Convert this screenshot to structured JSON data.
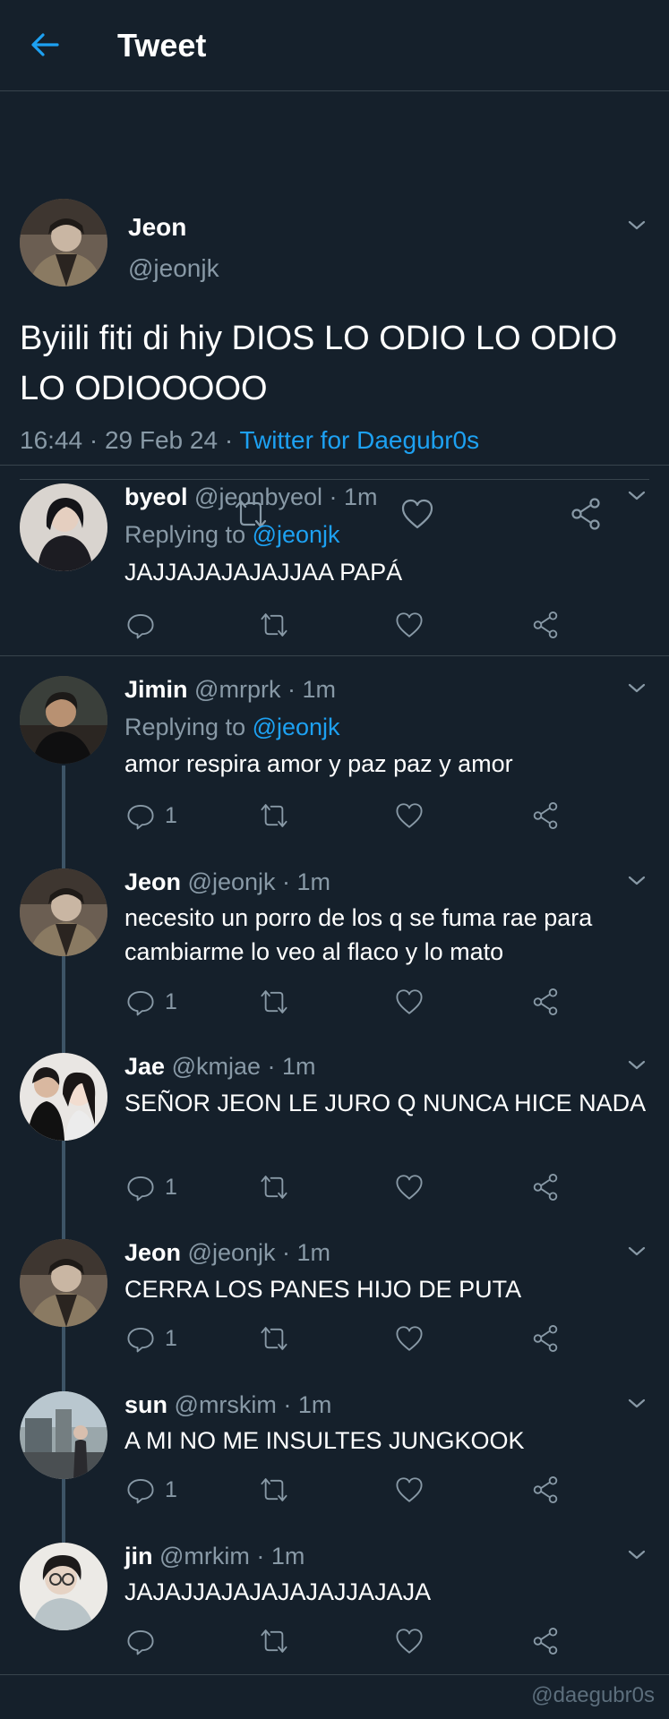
{
  "header": {
    "title": "Tweet"
  },
  "main_tweet": {
    "name": "Jeon",
    "handle": "@jeonjk",
    "text": "Byiili fiti di hiy DIOS LO ODIO LO ODIO LO ODIOOOOO",
    "time": "16:44 · 29 Feb 24 · ",
    "source": "Twitter for Daegubr0s"
  },
  "replies": [
    {
      "name": "byeol",
      "handle": "@jeonbyeol · 1m",
      "replying_prefix": "Replying to ",
      "replying_to": "@jeonjk",
      "text": "JAJJAJAJAJAJJAA PAPÁ",
      "reply_count": ""
    },
    {
      "name": "Jimin",
      "handle": "@mrprk · 1m",
      "replying_prefix": "Replying to ",
      "replying_to": "@jeonjk",
      "text": "amor respira amor y paz paz y amor",
      "reply_count": "1"
    },
    {
      "name": "Jeon",
      "handle": "@jeonjk · 1m",
      "text": "necesito un porro de los q se fuma rae para cambiarme lo veo al flaco y lo mato",
      "reply_count": "1"
    },
    {
      "name": "Jae",
      "handle": "@kmjae · 1m",
      "text": "SEÑOR JEON LE JURO Q NUNCA HICE NADA",
      "reply_count": "1"
    },
    {
      "name": "Jeon",
      "handle": "@jeonjk · 1m",
      "text": "CERRA LOS PANES HIJO DE PUTA",
      "reply_count": "1"
    },
    {
      "name": "sun",
      "handle": "@mrskim · 1m",
      "text": "A MI NO ME INSULTES JUNGKOOK",
      "reply_count": "1"
    },
    {
      "name": "jin",
      "handle": "@mrkim · 1m",
      "text": "JAJAJJAJAJAJAJAJJAJAJA",
      "reply_count": ""
    }
  ],
  "watermark": "@daegubr0s",
  "colors": {
    "background": "#15202b",
    "accent": "#1da1f2",
    "muted": "#8899a6",
    "divider": "#38444d"
  },
  "icons": [
    "back-arrow-icon",
    "chevron-down-icon",
    "reply-icon",
    "retweet-icon",
    "like-icon",
    "share-icon"
  ]
}
